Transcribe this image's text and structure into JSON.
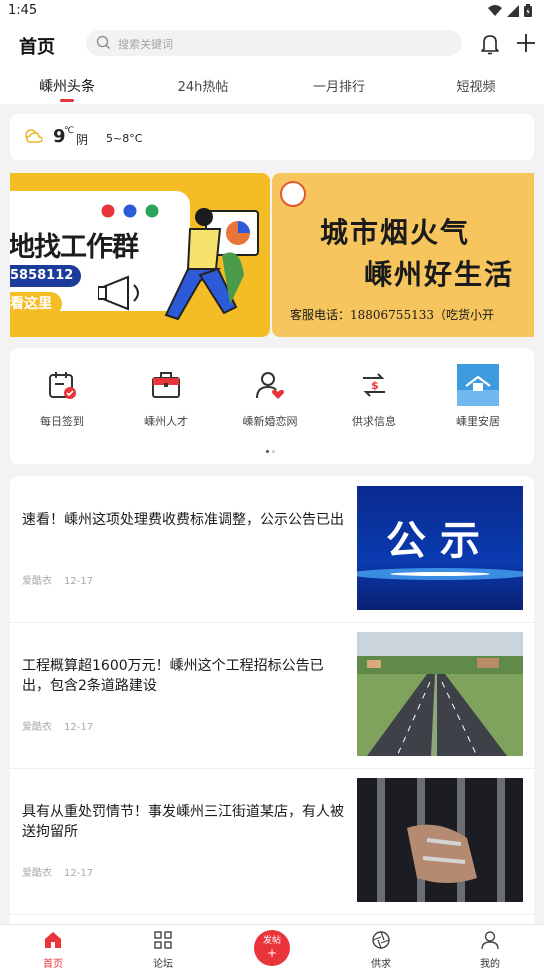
{
  "status_bar": {
    "time": "1:45",
    "icons": [
      "wifi-icon",
      "signal-icon",
      "battery-icon"
    ]
  },
  "header": {
    "title": "首页",
    "search_placeholder": "搜索关键词",
    "icons": [
      "bell-icon",
      "plus-icon"
    ]
  },
  "tabs": [
    {
      "label": "嵊州头条",
      "active": true
    },
    {
      "label": "24h热帖",
      "active": false
    },
    {
      "label": "一月排行",
      "active": false
    },
    {
      "label": "短视频",
      "active": false
    }
  ],
  "weather": {
    "temperature": "9",
    "unit": "℃",
    "condition": "阴",
    "range": "5~8°C",
    "icon": "cloudy-sun-icon"
  },
  "banners": [
    {
      "title": "地找工作群",
      "phone": "5858112",
      "button": "看这里",
      "accent": "#f5bd25"
    },
    {
      "line1": "城市烟火气",
      "line2": "嵊州好生活",
      "contact": "客服电话：18806755133（吃货小开",
      "accent": "#f6c55e"
    }
  ],
  "quick_links": [
    {
      "label": "每日签到",
      "icon": "calendar-check-icon"
    },
    {
      "label": "嵊州人才",
      "icon": "briefcase-icon"
    },
    {
      "label": "嵊新婚恋网",
      "icon": "person-heart-icon"
    },
    {
      "label": "供求信息",
      "icon": "exchange-money-icon"
    },
    {
      "label": "嵊里安居",
      "icon": "house-icon"
    }
  ],
  "articles": [
    {
      "title": "速看！嵊州这项处理费收费标准调整，公示公告已出",
      "author": "爱酷衣",
      "date": "12-17",
      "thumb_text": "公示"
    },
    {
      "title": "工程概算超1600万元！嵊州这个工程招标公告已出，包含2条道路建设",
      "author": "爱酷衣",
      "date": "12-17"
    },
    {
      "title": "具有从重处罚情节！事发嵊州三江街道某店，有人被送拘留所",
      "author": "爱酷衣",
      "date": "12-17"
    }
  ],
  "bottom_nav": [
    {
      "label": "首页",
      "icon": "home-icon",
      "active": true
    },
    {
      "label": "论坛",
      "icon": "grid-icon",
      "active": false
    },
    {
      "label": "发帖",
      "icon": "post-plus-icon",
      "active": false
    },
    {
      "label": "供求",
      "icon": "aperture-icon",
      "active": false
    },
    {
      "label": "我的",
      "icon": "user-icon",
      "active": false
    }
  ],
  "colors": {
    "accent": "#e8343a",
    "banner_blue": "#1c3c9b"
  }
}
